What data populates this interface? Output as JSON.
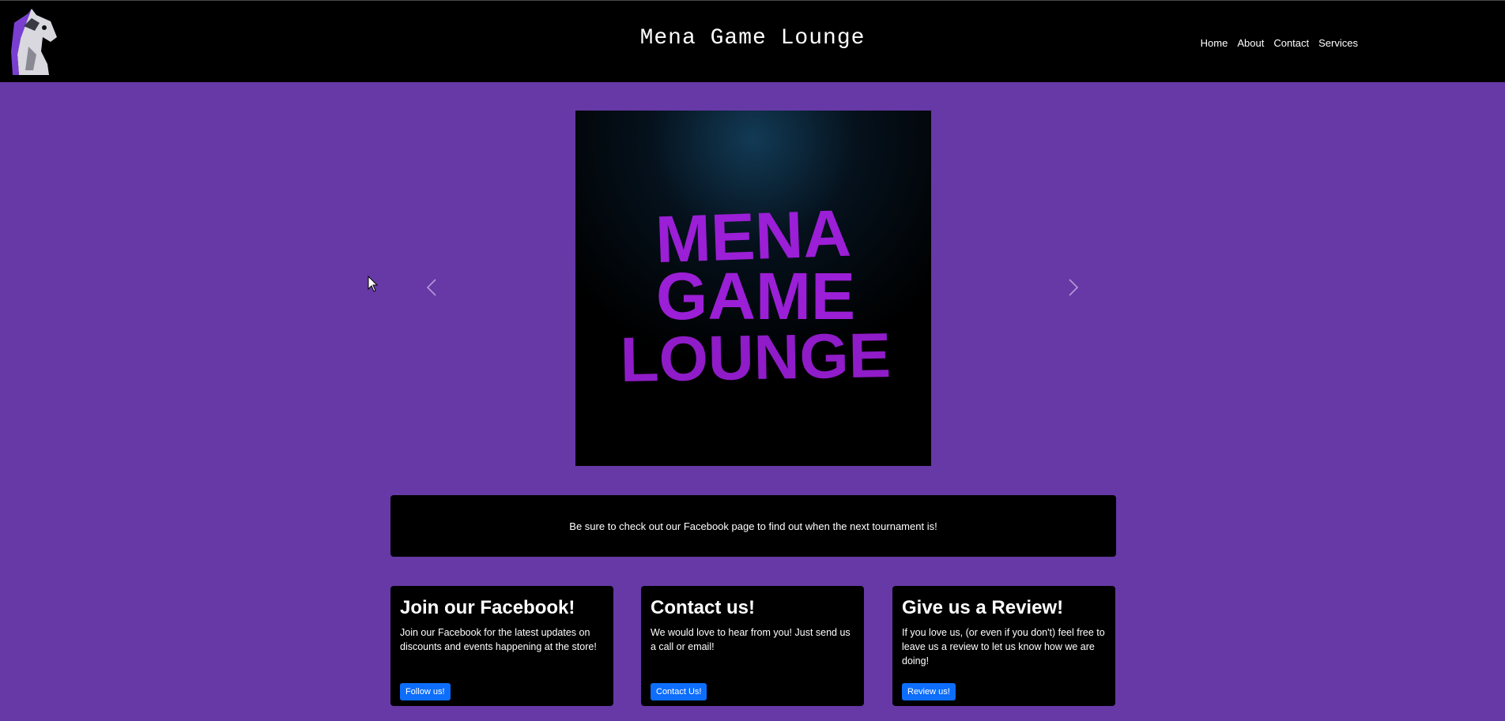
{
  "header": {
    "title": "Mena Game Lounge",
    "logo": "horse-head-logo",
    "nav": [
      "Home",
      "About",
      "Contact",
      "Services"
    ]
  },
  "carousel": {
    "slide_text": [
      "MENA",
      "GAME",
      "LOUNGE"
    ],
    "prev_icon": "chevron-left-icon",
    "next_icon": "chevron-right-icon"
  },
  "announcement": {
    "text": "Be sure to check out our Facebook page to find out when the next tournament is!"
  },
  "cards": [
    {
      "title": "Join our Facebook!",
      "body": "Join our Facebook for the latest updates on discounts and events happening at the store!",
      "button": "Follow us!"
    },
    {
      "title": "Contact us!",
      "body": "We would love to hear from you! Just send us a call or email!",
      "button": "Contact Us!"
    },
    {
      "title": "Give us a Review!",
      "body": "If you love us, (or even if you don't) feel free to leave us a review to let us know how we are doing!",
      "button": "Review us!"
    }
  ],
  "colors": {
    "page_bg": "#6639a6",
    "navbar_bg": "#000000",
    "card_bg": "#000000",
    "button_bg": "#0d6efd",
    "slide_text": "#9b1fd6"
  }
}
